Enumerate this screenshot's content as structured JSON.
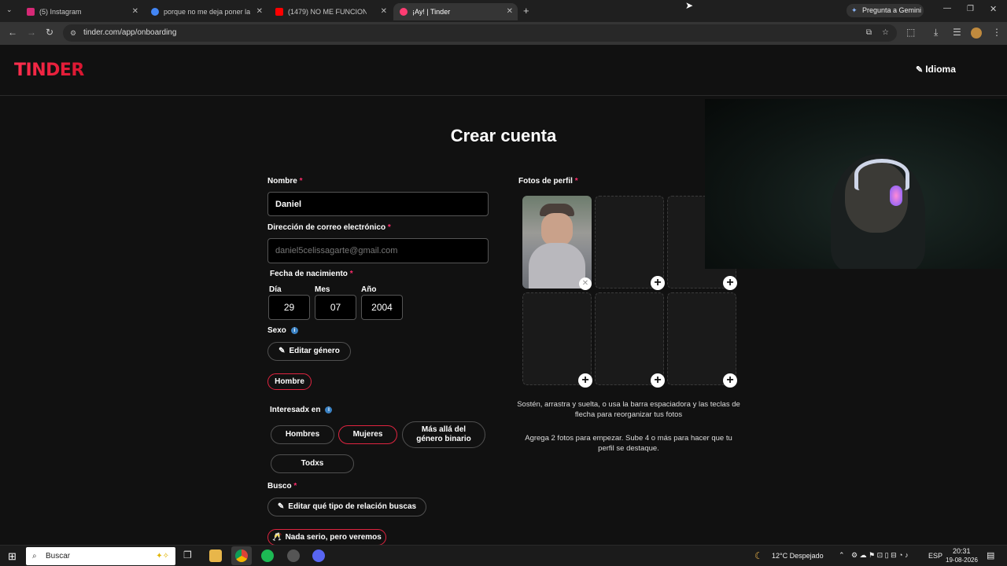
{
  "browser": {
    "tabs": [
      {
        "title": "(5) Instagram",
        "favicon_color": "#d62976"
      },
      {
        "title": "porque no me deja poner la ca",
        "favicon_color": "#4285f4"
      },
      {
        "title": "(1479) NO ME FUNCIONA LA C",
        "favicon_color": "#ff0000"
      },
      {
        "title": "¡Ay! | Tinder",
        "favicon_color": "#fe3c72"
      }
    ],
    "gemini_label": "Pregunta a Gemini",
    "url": "tinder.com/app/onboarding"
  },
  "header": {
    "logo": "TINDER",
    "language_label": "Idioma"
  },
  "form": {
    "title": "Crear cuenta",
    "name_label": "Nombre",
    "name_value": "Daniel",
    "email_label": "Dirección de correo electrónico",
    "email_placeholder": "daniel5celissagarte@gmail.com",
    "birth_label": "Fecha de nacimiento",
    "day_label": "Día",
    "day_value": "29",
    "month_label": "Mes",
    "month_value": "07",
    "year_label": "Año",
    "year_value": "2004",
    "sex_label": "Sexo",
    "edit_gender_label": "Editar género",
    "gender_selected": "Hombre",
    "interested_label": "Interesadx en",
    "interested_options": [
      "Hombres",
      "Mujeres",
      "Más allá del género binario",
      "Todxs"
    ],
    "interested_selected": "Mujeres",
    "looking_label": "Busco",
    "edit_relationship_label": "Editar qué tipo de relación buscas",
    "relationship_selected": "Nada serio, pero veremos",
    "required_mark": "*"
  },
  "photos": {
    "label": "Fotos de perfil",
    "help_reorder": "Sostén, arrastra y suelta, o usa la barra espaciadora y las teclas de flecha para reorganizar tus fotos",
    "help_count": "Agrega 2 fotos para empezar. Sube 4 o más para hacer que tu perfil se destaque.",
    "slots_filled": 1,
    "slots_total": 6
  },
  "taskbar": {
    "search_label": "Buscar",
    "weather": "12°C  Despejado",
    "lang": "ESP",
    "time": "20:31",
    "date": "19-08-2026"
  },
  "colors": {
    "accent": "#fd2c6b",
    "selected_border": "#e02440",
    "background": "#111111"
  }
}
